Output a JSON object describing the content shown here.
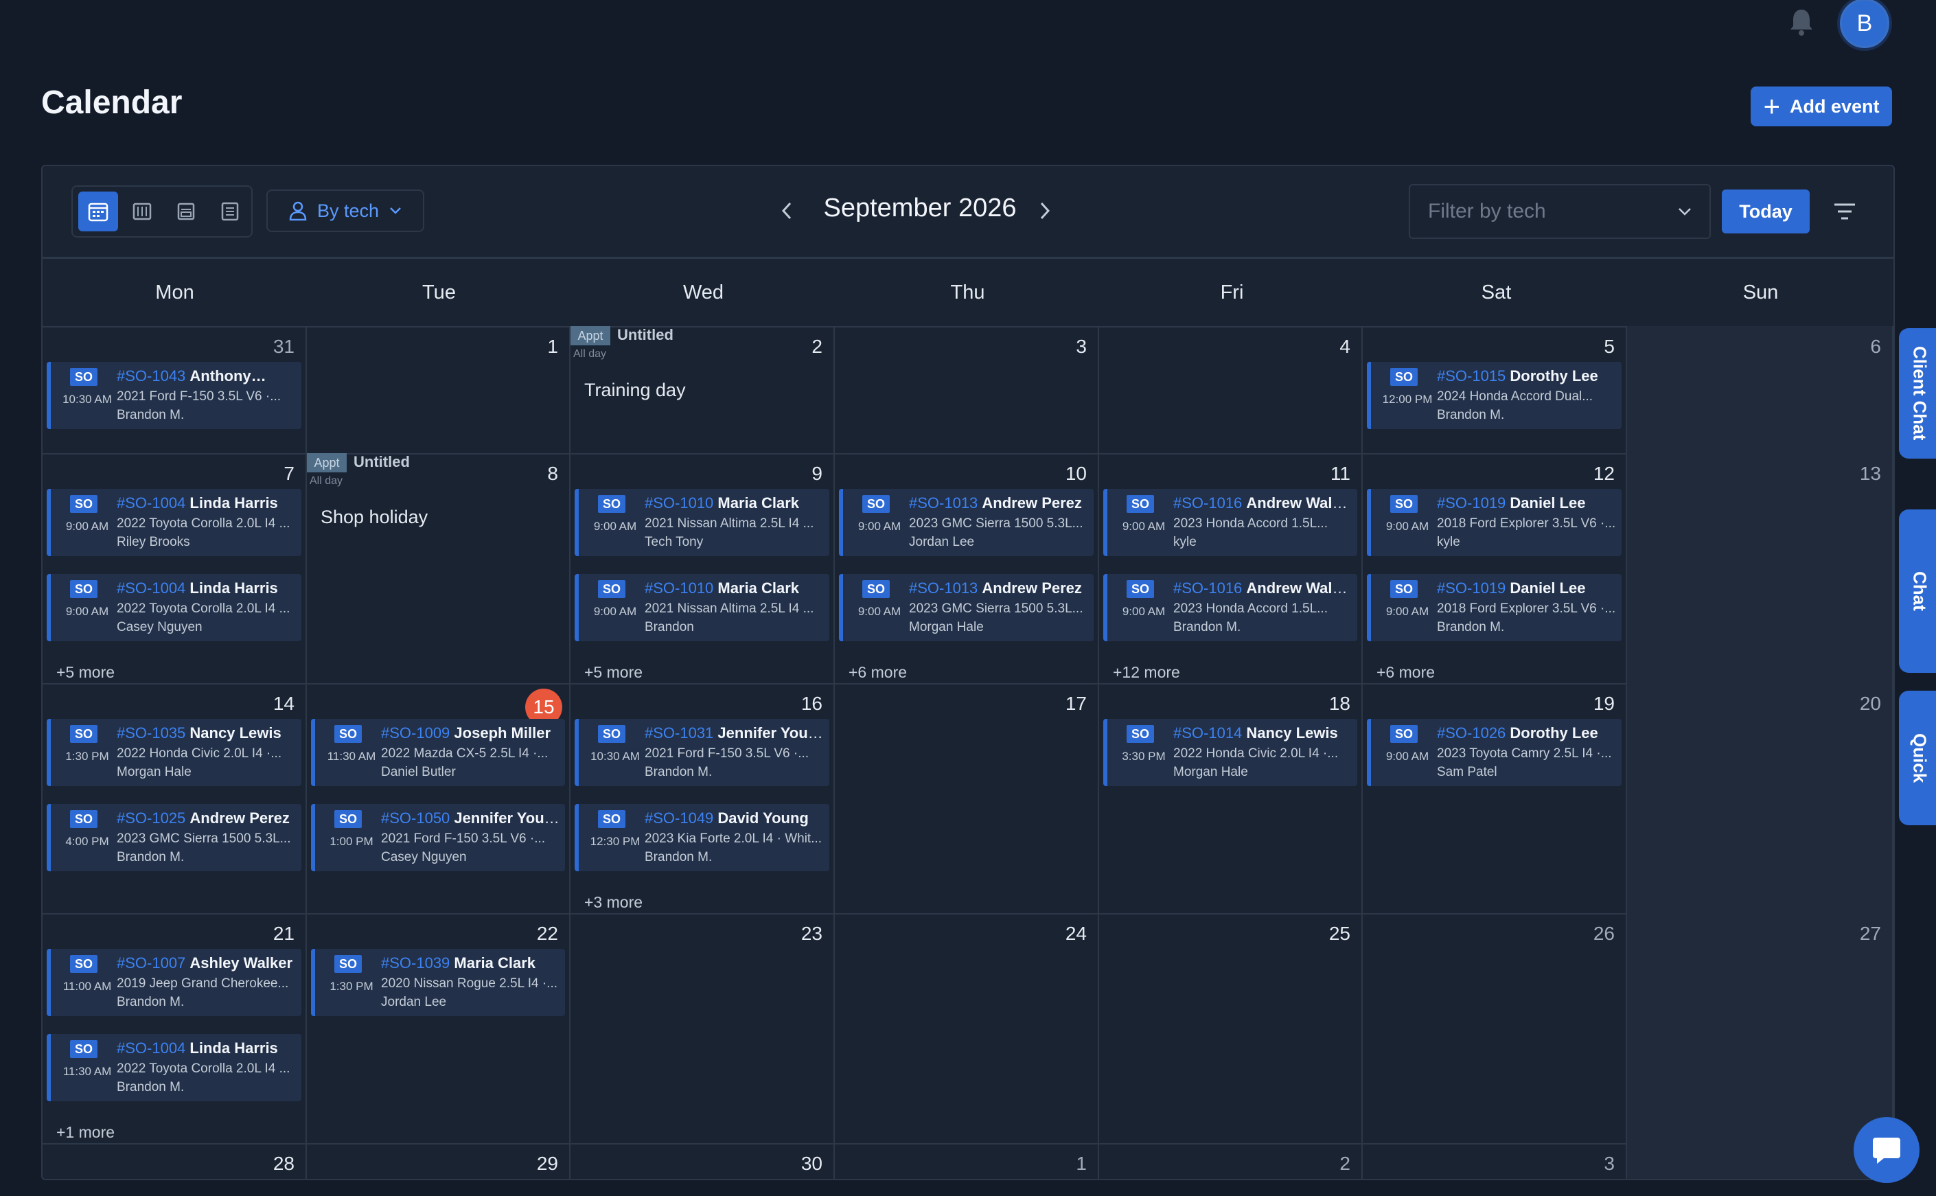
{
  "header": {
    "title": "Calendar",
    "add_event_label": "Add event",
    "avatar_initial": "B"
  },
  "toolbar": {
    "view_icons": [
      "month-view-icon",
      "week-view-icon",
      "day-view-icon",
      "list-view-icon"
    ],
    "active_view": "month",
    "by_tech_label": "By tech",
    "month_title": "September 2026",
    "filter_placeholder": "Filter by tech",
    "today_label": "Today"
  },
  "weekdays": [
    "Mon",
    "Tue",
    "Wed",
    "Thu",
    "Fri",
    "Sat",
    "Sun"
  ],
  "weeks": [
    [
      {
        "day": "31",
        "muted": true,
        "events": [
          {
            "tag": "SO",
            "number": "#SO-1043",
            "name": "Anthony…",
            "time": "10:30 AM",
            "vehicle": "2021 Ford F-150 3.5L V6 ·...",
            "tech": "Brandon M."
          }
        ]
      },
      {
        "day": "1",
        "events": []
      },
      {
        "day": "2",
        "appt": {
          "tag": "Appt",
          "title": "Untitled",
          "allday": "All day",
          "body": "Training day"
        },
        "events": []
      },
      {
        "day": "3",
        "events": []
      },
      {
        "day": "4",
        "events": []
      },
      {
        "day": "5",
        "events": [
          {
            "tag": "SO",
            "number": "#SO-1015",
            "name": "Dorothy Lee",
            "time": "12:00 PM",
            "vehicle": "2024 Honda Accord Dual...",
            "tech": "Brandon M."
          }
        ]
      },
      {
        "day": "6",
        "muted": true,
        "events": []
      }
    ],
    [
      {
        "day": "7",
        "events": [
          {
            "tag": "SO",
            "number": "#SO-1004",
            "name": "Linda Harris",
            "time": "9:00 AM",
            "vehicle": "2022 Toyota Corolla 2.0L I4 ...",
            "tech": "Riley Brooks"
          },
          {
            "tag": "SO",
            "number": "#SO-1004",
            "name": "Linda Harris",
            "time": "9:00 AM",
            "vehicle": "2022 Toyota Corolla 2.0L I4 ...",
            "tech": "Casey Nguyen"
          }
        ],
        "more": "+5 more"
      },
      {
        "day": "8",
        "appt": {
          "tag": "Appt",
          "title": "Untitled",
          "allday": "All day",
          "body": "Shop holiday"
        },
        "events": []
      },
      {
        "day": "9",
        "events": [
          {
            "tag": "SO",
            "number": "#SO-1010",
            "name": "Maria Clark",
            "time": "9:00 AM",
            "vehicle": "2021 Nissan Altima 2.5L I4 ...",
            "tech": "Tech Tony"
          },
          {
            "tag": "SO",
            "number": "#SO-1010",
            "name": "Maria Clark",
            "time": "9:00 AM",
            "vehicle": "2021 Nissan Altima 2.5L I4 ...",
            "tech": "Brandon"
          }
        ],
        "more": "+5 more"
      },
      {
        "day": "10",
        "events": [
          {
            "tag": "SO",
            "number": "#SO-1013",
            "name": "Andrew Perez",
            "time": "9:00 AM",
            "vehicle": "2023 GMC Sierra 1500 5.3L...",
            "tech": "Jordan Lee"
          },
          {
            "tag": "SO",
            "number": "#SO-1013",
            "name": "Andrew Perez",
            "time": "9:00 AM",
            "vehicle": "2023 GMC Sierra 1500 5.3L...",
            "tech": "Morgan Hale"
          }
        ],
        "more": "+6 more"
      },
      {
        "day": "11",
        "events": [
          {
            "tag": "SO",
            "number": "#SO-1016",
            "name": "Andrew Walker",
            "time": "9:00 AM",
            "vehicle": "2023 Honda Accord 1.5L...",
            "tech": "kyle"
          },
          {
            "tag": "SO",
            "number": "#SO-1016",
            "name": "Andrew Walker",
            "time": "9:00 AM",
            "vehicle": "2023 Honda Accord 1.5L...",
            "tech": "Brandon M."
          }
        ],
        "more": "+12 more"
      },
      {
        "day": "12",
        "events": [
          {
            "tag": "SO",
            "number": "#SO-1019",
            "name": "Daniel Lee",
            "time": "9:00 AM",
            "vehicle": "2018 Ford Explorer 3.5L V6 ·...",
            "tech": "kyle"
          },
          {
            "tag": "SO",
            "number": "#SO-1019",
            "name": "Daniel Lee",
            "time": "9:00 AM",
            "vehicle": "2018 Ford Explorer 3.5L V6 ·...",
            "tech": "Brandon M."
          }
        ],
        "more": "+6 more"
      },
      {
        "day": "13",
        "muted": true,
        "events": []
      }
    ],
    [
      {
        "day": "14",
        "events": [
          {
            "tag": "SO",
            "number": "#SO-1035",
            "name": "Nancy Lewis",
            "time": "1:30 PM",
            "vehicle": "2022 Honda Civic 2.0L I4 ·...",
            "tech": "Morgan Hale"
          },
          {
            "tag": "SO",
            "number": "#SO-1025",
            "name": "Andrew Perez",
            "time": "4:00 PM",
            "vehicle": "2023 GMC Sierra 1500 5.3L...",
            "tech": "Brandon M."
          }
        ]
      },
      {
        "day": "15",
        "today": true,
        "events": [
          {
            "tag": "SO",
            "number": "#SO-1009",
            "name": "Joseph Miller",
            "time": "11:30 AM",
            "vehicle": "2022 Mazda CX-5 2.5L I4 ·...",
            "tech": "Daniel Butler"
          },
          {
            "tag": "SO",
            "number": "#SO-1050",
            "name": "Jennifer Young",
            "time": "1:00 PM",
            "vehicle": "2021 Ford F-150 3.5L V6 ·...",
            "tech": "Casey Nguyen"
          }
        ]
      },
      {
        "day": "16",
        "events": [
          {
            "tag": "SO",
            "number": "#SO-1031",
            "name": "Jennifer Young",
            "time": "10:30 AM",
            "vehicle": "2021 Ford F-150 3.5L V6 ·...",
            "tech": "Brandon M."
          },
          {
            "tag": "SO",
            "number": "#SO-1049",
            "name": "David Young",
            "time": "12:30 PM",
            "vehicle": "2023 Kia Forte 2.0L I4 · Whit...",
            "tech": "Brandon M."
          }
        ],
        "more": "+3 more"
      },
      {
        "day": "17",
        "events": []
      },
      {
        "day": "18",
        "events": [
          {
            "tag": "SO",
            "number": "#SO-1014",
            "name": "Nancy Lewis",
            "time": "3:30 PM",
            "vehicle": "2022 Honda Civic 2.0L I4 ·...",
            "tech": "Morgan Hale"
          }
        ]
      },
      {
        "day": "19",
        "events": [
          {
            "tag": "SO",
            "number": "#SO-1026",
            "name": "Dorothy Lee",
            "time": "9:00 AM",
            "vehicle": "2023 Toyota Camry 2.5L I4 ·...",
            "tech": "Sam Patel"
          }
        ]
      },
      {
        "day": "20",
        "muted": true,
        "events": []
      }
    ],
    [
      {
        "day": "21",
        "events": [
          {
            "tag": "SO",
            "number": "#SO-1007",
            "name": "Ashley Walker",
            "time": "11:00 AM",
            "vehicle": "2019 Jeep Grand Cherokee...",
            "tech": "Brandon M."
          },
          {
            "tag": "SO",
            "number": "#SO-1004",
            "name": "Linda Harris",
            "time": "11:30 AM",
            "vehicle": "2022 Toyota Corolla 2.0L I4 ...",
            "tech": "Brandon M."
          }
        ],
        "more": "+1 more"
      },
      {
        "day": "22",
        "events": [
          {
            "tag": "SO",
            "number": "#SO-1039",
            "name": "Maria Clark",
            "time": "1:30 PM",
            "vehicle": "2020 Nissan Rogue 2.5L I4 ·...",
            "tech": "Jordan Lee"
          }
        ]
      },
      {
        "day": "23",
        "events": []
      },
      {
        "day": "24",
        "events": []
      },
      {
        "day": "25",
        "events": []
      },
      {
        "day": "26",
        "muted": true,
        "events": []
      },
      {
        "day": "27",
        "muted": true,
        "events": []
      }
    ],
    [
      {
        "day": "28",
        "events": []
      },
      {
        "day": "29",
        "events": []
      },
      {
        "day": "30",
        "events": []
      },
      {
        "day": "1",
        "muted": true,
        "events": []
      },
      {
        "day": "2",
        "muted": true,
        "events": []
      },
      {
        "day": "3",
        "muted": true,
        "events": []
      },
      {
        "day": "4",
        "muted": true,
        "events": []
      }
    ]
  ],
  "side_tabs": [
    "Client Chat",
    "Chat",
    "Quick"
  ],
  "colors": {
    "accent": "#2d6ad3",
    "today": "#e8563b",
    "background": "#131b28",
    "panel": "#1a2332",
    "event_bg": "#223149",
    "so_number": "#3d82f3"
  }
}
